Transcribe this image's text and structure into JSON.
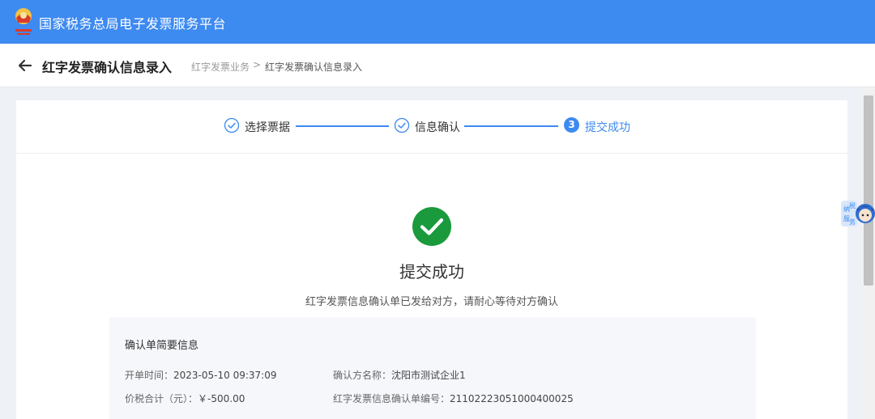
{
  "topbar": {
    "logo_icon": "tax-emblem-icon",
    "title": "国家税务总局电子发票服务平台"
  },
  "header": {
    "back_icon": "arrow-left-icon",
    "title": "红字发票确认信息录入",
    "breadcrumb": [
      "红字发票业务",
      "红字发票确认信息录入"
    ],
    "breadcrumb_separator": ">"
  },
  "steps": [
    {
      "label": "选择票据",
      "state": "done",
      "icon": "check-circle-icon"
    },
    {
      "label": "信息确认",
      "state": "done",
      "icon": "check-circle-icon"
    },
    {
      "number": "3",
      "label": "提交成功",
      "state": "active"
    }
  ],
  "result": {
    "icon": "success-check-icon",
    "title": "提交成功",
    "description": "红字发票信息确认单已发给对方，请耐心等待对方确认"
  },
  "summary": {
    "heading": "确认单简要信息",
    "open_time_label": "开单时间：",
    "open_time_value": "2023-05-10 09:37:09",
    "confirmer_label": "确认方名称：",
    "confirmer_value": "沈阳市测试企业1",
    "total_label": "价税合计（元）：",
    "total_value": "￥-500.00",
    "form_no_label": "红字发票信息确认单编号：",
    "form_no_value": "21102223051000400025"
  },
  "assistant": {
    "icon": "tax-assistant-avatar-icon",
    "label": "纳税\n服务"
  },
  "colors": {
    "brand_blue": "#3d8af0",
    "success_green": "#1a9a3c"
  }
}
